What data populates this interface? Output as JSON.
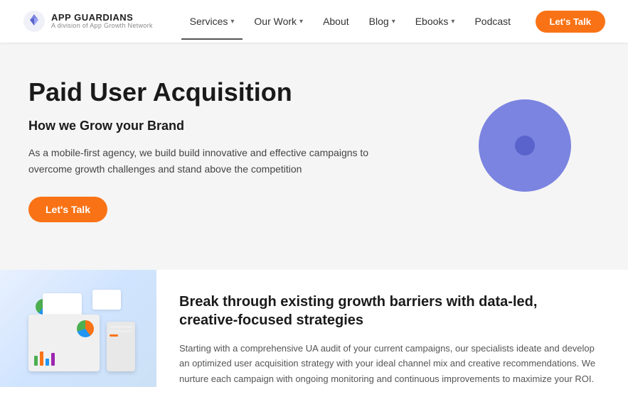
{
  "logo": {
    "main": "APP GUARDIANS",
    "sub": "A division of App Growth Network"
  },
  "nav": {
    "items": [
      {
        "label": "Services",
        "active": true,
        "hasDropdown": true
      },
      {
        "label": "Our Work",
        "active": false,
        "hasDropdown": true
      },
      {
        "label": "About",
        "active": false,
        "hasDropdown": false
      },
      {
        "label": "Blog",
        "active": false,
        "hasDropdown": true
      },
      {
        "label": "Ebooks",
        "active": false,
        "hasDropdown": true
      },
      {
        "label": "Podcast",
        "active": false,
        "hasDropdown": false
      }
    ],
    "cta_label": "Let's Talk"
  },
  "hero": {
    "title": "Paid User Acquisition",
    "subtitle": "How we Grow your Brand",
    "description": "As a mobile-first agency, we build build innovative and effective campaigns to overcome growth challenges and stand above the competition",
    "cta_label": "Let's Talk"
  },
  "lower": {
    "title": "Break through existing growth barriers with data-led, creative-focused strategies",
    "description": "Starting with a comprehensive UA audit of your current campaigns, our specialists ideate and develop an optimized user acquisition strategy with your ideal channel mix and creative recommendations. We nurture each campaign with ongoing monitoring and continuous improvements to maximize your ROI."
  },
  "icons": {
    "chevron": "▾",
    "logo_symbol": "G"
  }
}
